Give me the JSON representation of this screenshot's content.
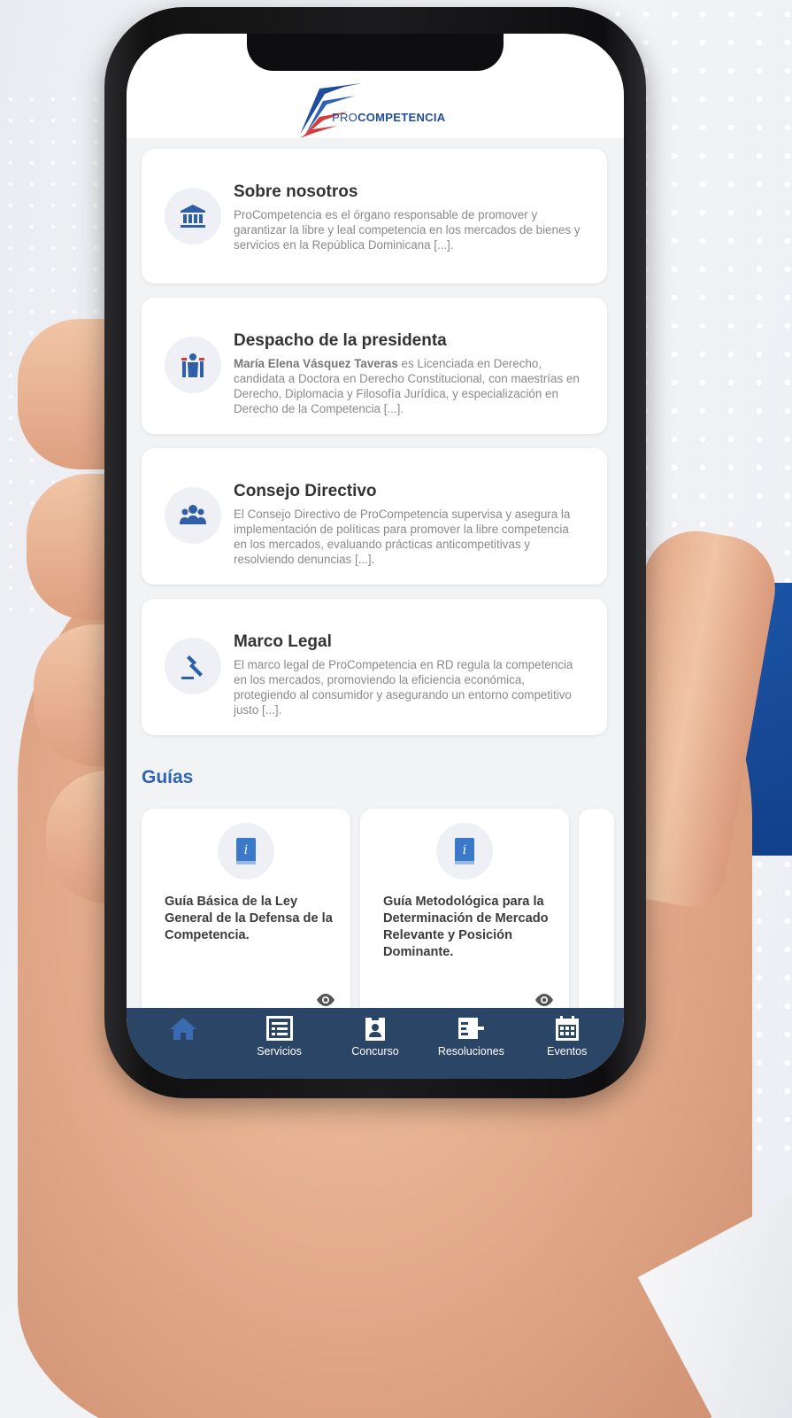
{
  "app": {
    "logo": {
      "pro": "PRO",
      "competencia": "COMPETENCIA"
    }
  },
  "cards": [
    {
      "icon": "institution-icon",
      "title": "Sobre nosotros",
      "body": "ProCompetencia es el órgano responsable de promover y garantizar la libre y leal competencia en los mercados de bienes y servicios en la República Dominicana [...]."
    },
    {
      "icon": "president-icon",
      "title": "Despacho de la presidenta",
      "body_bold": "María Elena Vásquez Taveras",
      "body": " es Licenciada en Derecho, candidata a Doctora en Derecho Constitucional, con maestrías en Derecho, Diplomacia y Filosofía Jurídica, y especialización en Derecho de la Competencia  [...]."
    },
    {
      "icon": "users-group-icon",
      "title": "Consejo Directivo",
      "body": "El Consejo Directivo de ProCompetencia supervisa y asegura la implementación de políticas para promover la libre competencia en los mercados, evaluando prácticas anticompetitivas y resolviendo denuncias  [...]."
    },
    {
      "icon": "gavel-icon",
      "title": "Marco Legal",
      "body": "El marco legal de ProCompetencia en RD regula la competencia en los mercados, promoviendo la eficiencia económica, protegiendo al consumidor y asegurando un entorno competitivo justo  [...]."
    }
  ],
  "guides": {
    "section_title": "Guías",
    "items": [
      {
        "icon": "info-book-icon",
        "title": "Guía Básica de la Ley General de la Defensa de la Competencia."
      },
      {
        "icon": "info-book-icon",
        "title": "Guía Metodológica para la Determinación de Mercado Relevante y Posición Dominante."
      }
    ]
  },
  "tabbar": {
    "items": [
      {
        "label": "",
        "icon": "home-icon",
        "active": true
      },
      {
        "label": "Servicios",
        "icon": "list-icon",
        "active": false
      },
      {
        "label": "Concurso",
        "icon": "badge-icon",
        "active": false
      },
      {
        "label": "Resoluciones",
        "icon": "document-arrow-icon",
        "active": false
      },
      {
        "label": "Eventos",
        "icon": "calendar-icon",
        "active": false
      }
    ]
  },
  "colors": {
    "accent": "#2f64b3",
    "tabbar": "#2b4567",
    "brand_red": "#d63a3a",
    "brand_blue": "#1f4d9a"
  }
}
